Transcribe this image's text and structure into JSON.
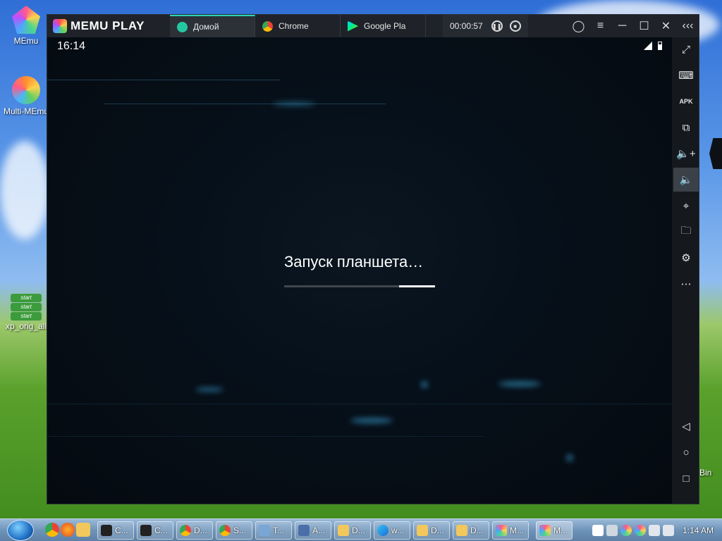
{
  "desktop": {
    "icons": [
      {
        "label": "MEmu",
        "icon": "memu-app-icon"
      },
      {
        "label": "Multi-MEmu",
        "icon": "multi-memu-app-icon"
      },
      {
        "label": "xp_orig_all",
        "icon": "xp-shortcut-icon",
        "badge": "start"
      }
    ],
    "recycle_bin_fragment": "Bin"
  },
  "emulator": {
    "brand": "MEMU PLAY",
    "tabs": [
      {
        "label": "Домой",
        "icon": "home-app-icon",
        "active": true
      },
      {
        "label": "Chrome",
        "icon": "chrome-icon",
        "active": false
      },
      {
        "label": "Google Pla",
        "icon": "google-play-icon",
        "active": false
      }
    ],
    "timer": "00:00:57",
    "status_time": "16:14",
    "loading_text": "Запуск планшета…",
    "progress_fraction": 0.24,
    "accent": "#2ad4b8",
    "sidebar_buttons": [
      "fullscreen-icon",
      "keyboard-icon",
      "apk-icon",
      "multi-window-icon",
      "volume-up-icon",
      "volume-down-icon",
      "location-icon",
      "folder-icon",
      "settings-icon",
      "more-icon",
      "back-icon",
      "home-icon",
      "recents-icon"
    ],
    "apk_label": "APK"
  },
  "taskbar": {
    "items": [
      "C...",
      "C...",
      "D...",
      "S...",
      "T...",
      "A...",
      "D...",
      "w...",
      "D...",
      "D...",
      "M...",
      "M..."
    ],
    "clock": "1:14 AM"
  }
}
